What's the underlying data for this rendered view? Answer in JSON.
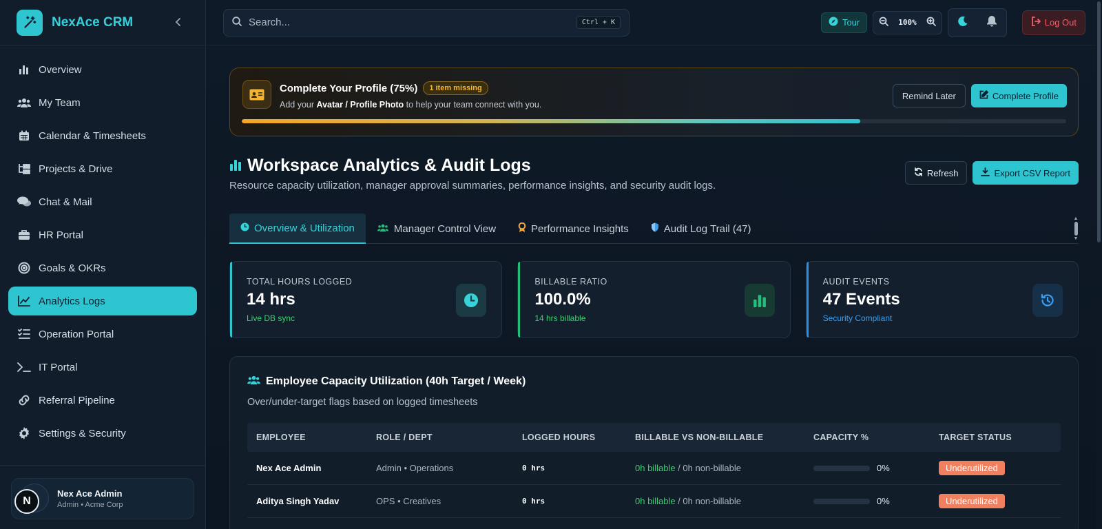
{
  "app": {
    "name": "NexAce CRM"
  },
  "sidebar": {
    "items": [
      {
        "label": "Overview",
        "icon": "bar-chart-icon"
      },
      {
        "label": "My Team",
        "icon": "users-icon"
      },
      {
        "label": "Calendar & Timesheets",
        "icon": "calendar-icon"
      },
      {
        "label": "Projects & Drive",
        "icon": "folder-tree-icon"
      },
      {
        "label": "Chat & Mail",
        "icon": "chat-icon"
      },
      {
        "label": "HR Portal",
        "icon": "briefcase-icon"
      },
      {
        "label": "Goals & OKRs",
        "icon": "target-icon"
      },
      {
        "label": "Analytics Logs",
        "icon": "line-chart-icon",
        "active": true
      },
      {
        "label": "Operation Portal",
        "icon": "list-check-icon"
      },
      {
        "label": "IT Portal",
        "icon": "terminal-icon"
      },
      {
        "label": "Referral Pipeline",
        "icon": "link-icon"
      },
      {
        "label": "Settings & Security",
        "icon": "gear-icon"
      }
    ],
    "user": {
      "initial": "N",
      "name": "Nex Ace Admin",
      "role": "Admin • Acme Corp"
    }
  },
  "topbar": {
    "search_placeholder": "Search...",
    "shortcut": "Ctrl + K",
    "tour_label": "Tour",
    "zoom_level": "100%",
    "logout_label": "Log Out"
  },
  "profile_banner": {
    "title": "Complete Your Profile (75%)",
    "badge": "1 item missing",
    "sub_prefix": "Add your",
    "sub_bold": "Avatar / Profile Photo",
    "sub_suffix": "to help your team connect with you.",
    "remind_label": "Remind Later",
    "complete_label": "Complete Profile",
    "progress": 0.75
  },
  "page": {
    "title": "Workspace Analytics & Audit Logs",
    "subtitle": "Resource capacity utilization, manager approval summaries, performance insights, and security audit logs.",
    "refresh_label": "Refresh",
    "export_label": "Export CSV Report"
  },
  "tabs": [
    {
      "label": "Overview & Utilization",
      "icon": "clock-icon",
      "active": true
    },
    {
      "label": "Manager Control View",
      "icon": "users-icon"
    },
    {
      "label": "Performance Insights",
      "icon": "award-icon"
    },
    {
      "label": "Audit Log Trail (47)",
      "icon": "shield-icon"
    }
  ],
  "stats": [
    {
      "label": "TOTAL HOURS LOGGED",
      "value": "14 hrs",
      "note": "Live DB sync",
      "icon": "clock-icon"
    },
    {
      "label": "BILLABLE RATIO",
      "value": "100.0%",
      "note": "14 hrs billable",
      "icon": "bar-chart-icon"
    },
    {
      "label": "AUDIT EVENTS",
      "value": "47 Events",
      "note": "Security Compliant",
      "icon": "history-icon"
    }
  ],
  "utilization": {
    "title": "Employee Capacity Utilization (40h Target / Week)",
    "subtitle": "Over/under-target flags based on logged timesheets",
    "columns": [
      "EMPLOYEE",
      "ROLE / DEPT",
      "LOGGED HOURS",
      "BILLABLE VS NON-BILLABLE",
      "CAPACITY %",
      "TARGET STATUS"
    ],
    "rows": [
      {
        "name": "Nex Ace Admin",
        "role": "Admin • Operations",
        "hours": "0 hrs",
        "billable": "0h billable",
        "non_billable": "/ 0h non-billable",
        "capacity": "0%",
        "status": "Underutilized"
      },
      {
        "name": "Aditya Singh Yadav",
        "role": "OPS • Creatives",
        "hours": "0 hrs",
        "billable": "0h billable",
        "non_billable": "/ 0h non-billable",
        "capacity": "0%",
        "status": "Underutilized"
      }
    ]
  }
}
